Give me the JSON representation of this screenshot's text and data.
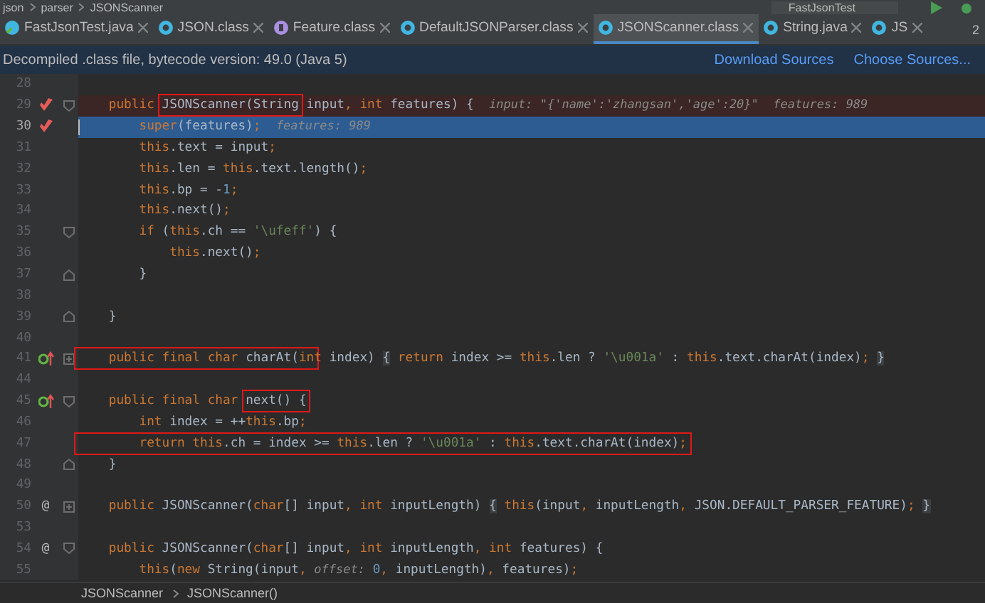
{
  "breadcrumb_top": {
    "items": [
      "json",
      "parser",
      "JSONScanner"
    ],
    "run_config": "FastJsonTest"
  },
  "tabs": [
    {
      "label": "FastJsonTest.java",
      "kind": "java",
      "selected": false
    },
    {
      "label": "JSON.class",
      "kind": "class",
      "selected": false
    },
    {
      "label": "Feature.class",
      "kind": "enum",
      "selected": false
    },
    {
      "label": "DefaultJSONParser.class",
      "kind": "class",
      "selected": false
    },
    {
      "label": "JSONScanner.class",
      "kind": "class",
      "selected": true
    },
    {
      "label": "String.java",
      "kind": "class",
      "selected": false
    },
    {
      "label": "JS",
      "kind": "class",
      "selected": false
    }
  ],
  "tab_overflow": "2",
  "info_bar": {
    "message": "Decompiled .class file, bytecode version: 49.0 (Java 5)",
    "links": [
      "Download Sources",
      "Choose Sources..."
    ]
  },
  "lines": [
    {
      "number": "28",
      "kind": "plain"
    },
    {
      "number": "29",
      "kind": "breakpoint",
      "gutter_icon": {
        "kind": "breakpoint"
      },
      "fold": {
        "kind": "open"
      },
      "segments": [
        {
          "kind": "code",
          "tokens": [
            {
              "kind": "keyword",
              "text": "    public "
            }
          ]
        },
        {
          "kind": "boxed",
          "tokens": [
            {
              "kind": "plain",
              "text": "JSONScanner(String"
            }
          ]
        },
        {
          "kind": "code",
          "tokens": [
            {
              "kind": "plain",
              "text": " input"
            },
            {
              "kind": "keyword",
              "text": ", int "
            },
            {
              "kind": "plain",
              "text": "features) {  "
            }
          ]
        },
        {
          "kind": "hint",
          "text": "input: \"{'name':'zhangsan','age':20}\"  features: 989"
        }
      ]
    },
    {
      "number": "30",
      "kind": "execution",
      "gutter_icon": {
        "kind": "breakpoint"
      },
      "segments": [
        {
          "kind": "code",
          "tokens": [
            {
              "kind": "keyword",
              "text": "        super"
            },
            {
              "kind": "plain",
              "text": "(features)"
            },
            {
              "kind": "keyword",
              "text": ";  "
            }
          ]
        },
        {
          "kind": "hint",
          "text": "features: 989"
        }
      ]
    },
    {
      "number": "31",
      "kind": "plain",
      "segments": [
        {
          "kind": "code",
          "tokens": [
            {
              "kind": "keyword",
              "text": "        this"
            },
            {
              "kind": "plain",
              "text": ".text = input"
            },
            {
              "kind": "keyword",
              "text": ";"
            }
          ]
        }
      ]
    },
    {
      "number": "32",
      "kind": "plain",
      "segments": [
        {
          "kind": "code",
          "tokens": [
            {
              "kind": "keyword",
              "text": "        this"
            },
            {
              "kind": "plain",
              "text": ".len = "
            },
            {
              "kind": "keyword",
              "text": "this"
            },
            {
              "kind": "plain",
              "text": ".text.length()"
            },
            {
              "kind": "keyword",
              "text": ";"
            }
          ]
        }
      ]
    },
    {
      "number": "33",
      "kind": "plain",
      "segments": [
        {
          "kind": "code",
          "tokens": [
            {
              "kind": "keyword",
              "text": "        this"
            },
            {
              "kind": "plain",
              "text": ".bp = -"
            },
            {
              "kind": "number",
              "text": "1"
            },
            {
              "kind": "keyword",
              "text": ";"
            }
          ]
        }
      ]
    },
    {
      "number": "34",
      "kind": "plain",
      "segments": [
        {
          "kind": "code",
          "tokens": [
            {
              "kind": "keyword",
              "text": "        this"
            },
            {
              "kind": "plain",
              "text": ".next()"
            },
            {
              "kind": "keyword",
              "text": ";"
            }
          ]
        }
      ]
    },
    {
      "number": "35",
      "kind": "plain",
      "fold": {
        "kind": "open"
      },
      "segments": [
        {
          "kind": "code",
          "tokens": [
            {
              "kind": "keyword",
              "text": "        if "
            },
            {
              "kind": "plain",
              "text": "("
            },
            {
              "kind": "keyword",
              "text": "this"
            },
            {
              "kind": "plain",
              "text": ".ch == "
            },
            {
              "kind": "string",
              "text": "'\\ufeff'"
            },
            {
              "kind": "plain",
              "text": ") {"
            }
          ]
        }
      ]
    },
    {
      "number": "36",
      "kind": "plain",
      "segments": [
        {
          "kind": "code",
          "tokens": [
            {
              "kind": "keyword",
              "text": "            this"
            },
            {
              "kind": "plain",
              "text": ".next()"
            },
            {
              "kind": "keyword",
              "text": ";"
            }
          ]
        }
      ]
    },
    {
      "number": "37",
      "kind": "plain",
      "fold": {
        "kind": "close"
      },
      "segments": [
        {
          "kind": "code",
          "tokens": [
            {
              "kind": "plain",
              "text": "        }"
            }
          ]
        }
      ]
    },
    {
      "number": "38",
      "kind": "plain"
    },
    {
      "number": "39",
      "kind": "plain",
      "fold": {
        "kind": "close"
      },
      "segments": [
        {
          "kind": "code",
          "tokens": [
            {
              "kind": "plain",
              "text": "    }"
            }
          ]
        }
      ]
    },
    {
      "number": "40",
      "kind": "plain"
    },
    {
      "number": "41",
      "kind": "plain",
      "gutter_icon": {
        "kind": "implements"
      },
      "fold": {
        "kind": "collapsed"
      },
      "segments": [
        {
          "kind": "boxed",
          "tokens": [
            {
              "kind": "keyword",
              "text": "    public final char "
            },
            {
              "kind": "plain",
              "text": "charAt("
            },
            {
              "kind": "keyword",
              "text": "in"
            }
          ]
        },
        {
          "kind": "code",
          "tokens": [
            {
              "kind": "keyword",
              "text": "t "
            },
            {
              "kind": "plain",
              "text": "index) "
            },
            {
              "kind": "fold",
              "text": "{"
            },
            {
              "kind": "keyword",
              "text": " return "
            },
            {
              "kind": "plain",
              "text": "index >= "
            },
            {
              "kind": "keyword",
              "text": "this"
            },
            {
              "kind": "plain",
              "text": ".len ? "
            },
            {
              "kind": "string",
              "text": "'\\u001a'"
            },
            {
              "kind": "plain",
              "text": " : "
            },
            {
              "kind": "keyword",
              "text": "this"
            },
            {
              "kind": "plain",
              "text": ".text.charAt(index)"
            },
            {
              "kind": "keyword",
              "text": "; "
            },
            {
              "kind": "fold",
              "text": "}"
            }
          ]
        }
      ]
    },
    {
      "number": "44",
      "kind": "plain"
    },
    {
      "number": "45",
      "kind": "plain",
      "gutter_icon": {
        "kind": "implements"
      },
      "fold": {
        "kind": "open"
      },
      "segments": [
        {
          "kind": "code",
          "tokens": [
            {
              "kind": "keyword",
              "text": "    public final char "
            }
          ]
        },
        {
          "kind": "boxed",
          "tokens": [
            {
              "kind": "plain",
              "text": "next() {"
            }
          ]
        }
      ]
    },
    {
      "number": "46",
      "kind": "plain",
      "segments": [
        {
          "kind": "code",
          "tokens": [
            {
              "kind": "keyword",
              "text": "        int "
            },
            {
              "kind": "plain",
              "text": "index = ++"
            },
            {
              "kind": "keyword",
              "text": "this"
            },
            {
              "kind": "plain",
              "text": ".bp"
            },
            {
              "kind": "keyword",
              "text": ";"
            }
          ]
        }
      ]
    },
    {
      "number": "47",
      "kind": "plain",
      "segments": [
        {
          "kind": "boxed",
          "tokens": [
            {
              "kind": "keyword",
              "text": "        return this"
            },
            {
              "kind": "plain",
              "text": ".ch = index >= "
            },
            {
              "kind": "keyword",
              "text": "this"
            },
            {
              "kind": "plain",
              "text": ".len ? "
            },
            {
              "kind": "string",
              "text": "'\\u001a'"
            },
            {
              "kind": "plain",
              "text": " : "
            },
            {
              "kind": "keyword",
              "text": "this"
            },
            {
              "kind": "plain",
              "text": ".text.charAt(index)"
            },
            {
              "kind": "keyword",
              "text": ";"
            }
          ]
        }
      ]
    },
    {
      "number": "48",
      "kind": "plain",
      "fold": {
        "kind": "close"
      },
      "segments": [
        {
          "kind": "code",
          "tokens": [
            {
              "kind": "plain",
              "text": "    }"
            }
          ]
        }
      ]
    },
    {
      "number": "49",
      "kind": "plain"
    },
    {
      "number": "50",
      "kind": "plain",
      "gutter_icon": {
        "kind": "annotation",
        "symbol": "@"
      },
      "fold": {
        "kind": "collapsed"
      },
      "segments": [
        {
          "kind": "code",
          "tokens": [
            {
              "kind": "keyword",
              "text": "    public "
            },
            {
              "kind": "plain",
              "text": "JSONScanner("
            },
            {
              "kind": "keyword",
              "text": "char"
            },
            {
              "kind": "plain",
              "text": "[] input"
            },
            {
              "kind": "keyword",
              "text": ", int "
            },
            {
              "kind": "plain",
              "text": "inputLength) "
            },
            {
              "kind": "fold",
              "text": "{"
            },
            {
              "kind": "keyword",
              "text": " this"
            },
            {
              "kind": "plain",
              "text": "(input"
            },
            {
              "kind": "keyword",
              "text": ", "
            },
            {
              "kind": "plain",
              "text": "inputLength"
            },
            {
              "kind": "keyword",
              "text": ", "
            },
            {
              "kind": "plain",
              "text": "JSON.DEFAULT_PARSER_FEATURE)"
            },
            {
              "kind": "keyword",
              "text": "; "
            },
            {
              "kind": "fold",
              "text": "}"
            }
          ]
        }
      ]
    },
    {
      "number": "53",
      "kind": "plain"
    },
    {
      "number": "54",
      "kind": "plain",
      "gutter_icon": {
        "kind": "annotation",
        "symbol": "@"
      },
      "fold": {
        "kind": "open"
      },
      "segments": [
        {
          "kind": "code",
          "tokens": [
            {
              "kind": "keyword",
              "text": "    public "
            },
            {
              "kind": "plain",
              "text": "JSONScanner("
            },
            {
              "kind": "keyword",
              "text": "char"
            },
            {
              "kind": "plain",
              "text": "[] input"
            },
            {
              "kind": "keyword",
              "text": ", int "
            },
            {
              "kind": "plain",
              "text": "inputLength"
            },
            {
              "kind": "keyword",
              "text": ", int "
            },
            {
              "kind": "plain",
              "text": "features) {"
            }
          ]
        }
      ]
    },
    {
      "number": "55",
      "kind": "plain",
      "segments": [
        {
          "kind": "code",
          "tokens": [
            {
              "kind": "keyword",
              "text": "        this"
            },
            {
              "kind": "plain",
              "text": "("
            },
            {
              "kind": "keyword",
              "text": "new "
            },
            {
              "kind": "plain",
              "text": "String(input"
            },
            {
              "kind": "keyword",
              "text": ", "
            }
          ]
        },
        {
          "kind": "hint",
          "text": "offset:"
        },
        {
          "kind": "code",
          "tokens": [
            {
              "kind": "number",
              "text": " 0"
            },
            {
              "kind": "keyword",
              "text": ", "
            },
            {
              "kind": "plain",
              "text": "inputLength)"
            },
            {
              "kind": "keyword",
              "text": ", "
            },
            {
              "kind": "plain",
              "text": "features)"
            },
            {
              "kind": "keyword",
              "text": ";"
            }
          ]
        }
      ]
    }
  ],
  "breadcrumb_bottom": [
    "JSONScanner",
    "JSONScanner()"
  ]
}
